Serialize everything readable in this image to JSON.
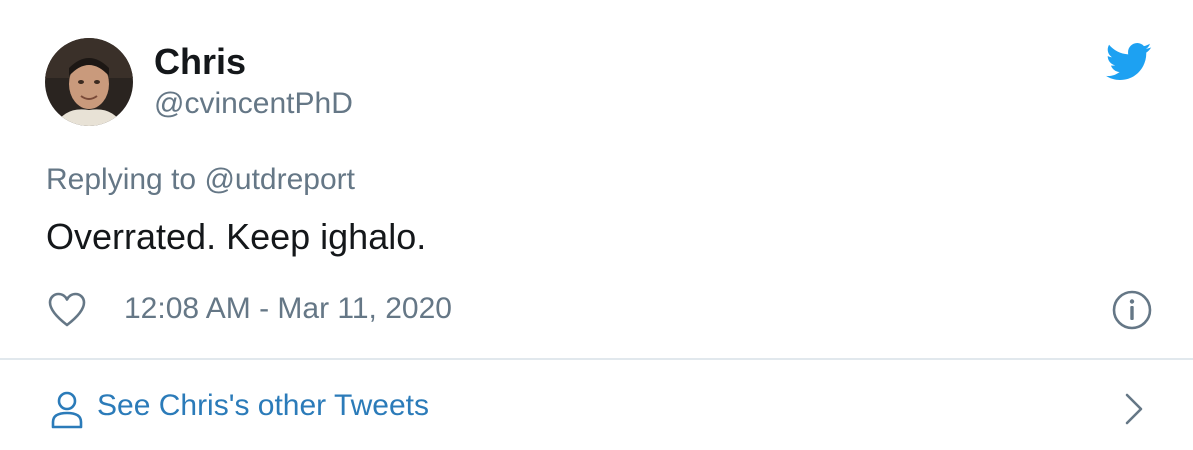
{
  "tweet": {
    "author_name": "Chris",
    "author_handle": "@cvincentPhD",
    "replying_prefix": "Replying to",
    "replying_to": "@utdreport",
    "text": "Overrated. Keep ighalo.",
    "timestamp": "12:08 AM - Mar 11, 2020"
  },
  "footer": {
    "other_tweets_label": "See Chris's other Tweets"
  },
  "icons": {
    "brand": "twitter-bird-icon",
    "like": "heart-icon",
    "info": "info-icon",
    "profile": "person-icon",
    "navigate": "chevron-right-icon"
  },
  "colors": {
    "brand_blue": "#1da1f2",
    "link_blue": "#2b7bb9",
    "text_primary": "#14171a",
    "text_secondary": "#657786",
    "divider": "#e1e8ed"
  }
}
